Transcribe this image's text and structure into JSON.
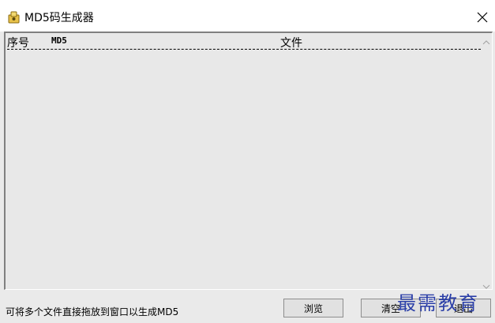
{
  "window": {
    "title": "MD5码生成器",
    "icon": "app-icon",
    "close_icon": "close-icon"
  },
  "list": {
    "columns": [
      "序号",
      "MD5",
      "文件"
    ],
    "rows": []
  },
  "status": {
    "text": "可将多个文件直接拖放到窗口以生成MD5"
  },
  "buttons": {
    "browse": "浏览",
    "clear": "清空",
    "exit": "退出"
  },
  "watermark": {
    "text": "最需教育"
  }
}
